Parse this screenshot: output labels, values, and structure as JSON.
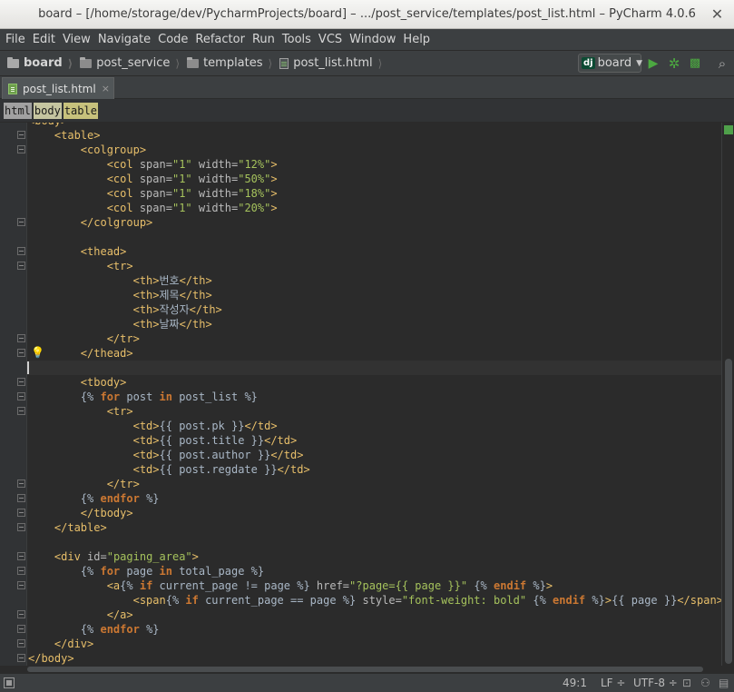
{
  "window": {
    "title": "board – [/home/storage/dev/PycharmProjects/board] – .../post_service/templates/post_list.html – PyCharm 4.0.6"
  },
  "menu": [
    "File",
    "Edit",
    "View",
    "Navigate",
    "Code",
    "Refactor",
    "Run",
    "Tools",
    "VCS",
    "Window",
    "Help"
  ],
  "breadcrumbs": [
    {
      "label": "board",
      "icon": "folder-icon"
    },
    {
      "label": "post_service",
      "icon": "folder-icon"
    },
    {
      "label": "templates",
      "icon": "folder-icon"
    },
    {
      "label": "post_list.html",
      "icon": "html-file-icon"
    }
  ],
  "run_config": {
    "badge": "dj",
    "label": "board"
  },
  "tabs": [
    {
      "label": "post_list.html",
      "close": "×"
    }
  ],
  "tag_path": [
    "html",
    "body",
    "table"
  ],
  "status": {
    "position": "49:1",
    "line_separator": "LF ÷",
    "encoding": "UTF-8 ÷"
  },
  "code": [
    "<body>",
    "    <table>",
    "        <colgroup>",
    "            <col span=\"1\" width=\"12%\">",
    "            <col span=\"1\" width=\"50%\">",
    "            <col span=\"1\" width=\"18%\">",
    "            <col span=\"1\" width=\"20%\">",
    "        </colgroup>",
    "",
    "        <thead>",
    "            <tr>",
    "                <th>번호</th>",
    "                <th>제목</th>",
    "                <th>작성자</th>",
    "                <th>날짜</th>",
    "            </tr>",
    "        </thead>",
    "",
    "        <tbody>",
    "        {% for post in post_list %}",
    "            <tr>",
    "                <td>{{ post.pk }}</td>",
    "                <td>{{ post.title }}</td>",
    "                <td>{{ post.author }}</td>",
    "                <td>{{ post.regdate }}</td>",
    "            </tr>",
    "        {% endfor %}",
    "        </tbody>",
    "    </table>",
    "",
    "    <div id=\"paging_area\">",
    "        {% for page in total_page %}",
    "            <a{% if current_page != page %} href=\"?page={{ page }}\" {% endif %}>",
    "                <span{% if current_page == page %} style=\"font-weight: bold\" {% endif %}>{{ page }}</span>",
    "            </a>",
    "        {% endfor %}",
    "    </div>",
    "</body>"
  ],
  "colors": {
    "tag": "#e8bf6a",
    "attribute": "#bababa",
    "value": "#a5c25c",
    "keyword": "#cc7832",
    "text": "#a9b7c6",
    "background": "#2b2b2b"
  }
}
